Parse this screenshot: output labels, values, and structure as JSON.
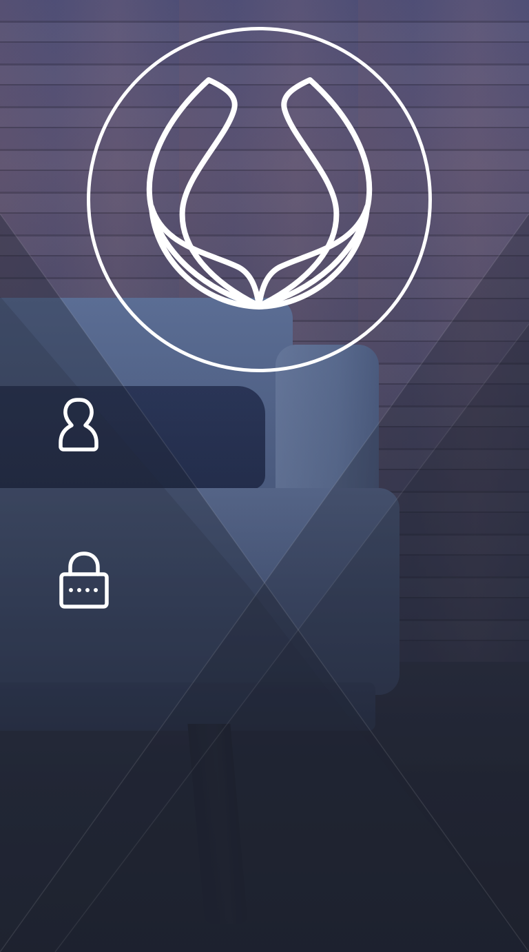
{
  "login": {
    "logo_icon": "lotus-logo-icon",
    "username": {
      "icon": "user-icon",
      "value": "",
      "placeholder": ""
    },
    "password": {
      "icon": "lock-password-icon",
      "value": "",
      "placeholder": ""
    }
  },
  "colors": {
    "foreground": "#ffffff",
    "overlay_dark": "#2a2f3e",
    "sofa_blue": "#6e83ae"
  }
}
